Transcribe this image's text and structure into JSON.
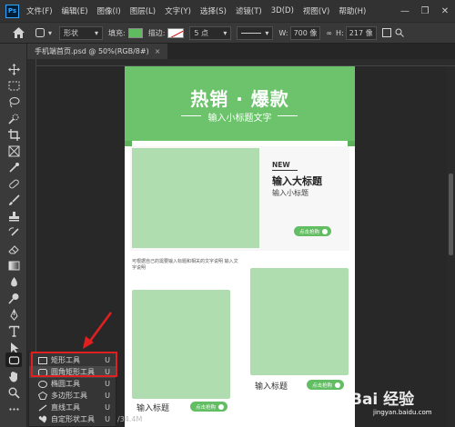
{
  "menubar": {
    "logo": "Ps",
    "items": [
      "文件(F)",
      "编辑(E)",
      "图像(I)",
      "图层(L)",
      "文字(Y)",
      "选择(S)",
      "滤镜(T)",
      "3D(D)",
      "视图(V)",
      "帮助(H)"
    ]
  },
  "options": {
    "mode": "形状",
    "fill_label": "填充:",
    "stroke_label": "描边:",
    "stroke_size": "5 点",
    "w_label": "W:",
    "w_value": "700 像",
    "h_label": "H:",
    "h_value": "217 像",
    "fill_color": "#5fbc5f"
  },
  "document": {
    "tab_title": "手机端首页.psd @ 50%(RGB/8#)",
    "close": "×",
    "status": "/34.4M"
  },
  "canvas": {
    "banner_title": "热销 · 爆款",
    "banner_subtitle": "输入小标题文字",
    "new_label": "NEW",
    "feature_title": "输入大标题",
    "feature_subtitle": "输入小标题",
    "cta": "点击抢购",
    "desc": "可根据自己的需要输入标题和相关的文字说明 输入文字说明",
    "product_title_1": "输入标题",
    "product_title_2": "输入标题",
    "brand_green": "#6cc36c"
  },
  "flyout": {
    "items": [
      {
        "label": "矩形工具",
        "key": "U",
        "icon": "rectangle-icon"
      },
      {
        "label": "圆角矩形工具",
        "key": "U",
        "icon": "rounded-rectangle-icon"
      },
      {
        "label": "椭圆工具",
        "key": "U",
        "icon": "ellipse-icon"
      },
      {
        "label": "多边形工具",
        "key": "U",
        "icon": "polygon-icon"
      },
      {
        "label": "直线工具",
        "key": "U",
        "icon": "line-icon"
      },
      {
        "label": "自定形状工具",
        "key": "U",
        "icon": "custom-shape-icon"
      }
    ]
  },
  "watermark": {
    "text": "Bai 经验",
    "url": "jingyan.baidu.com"
  }
}
